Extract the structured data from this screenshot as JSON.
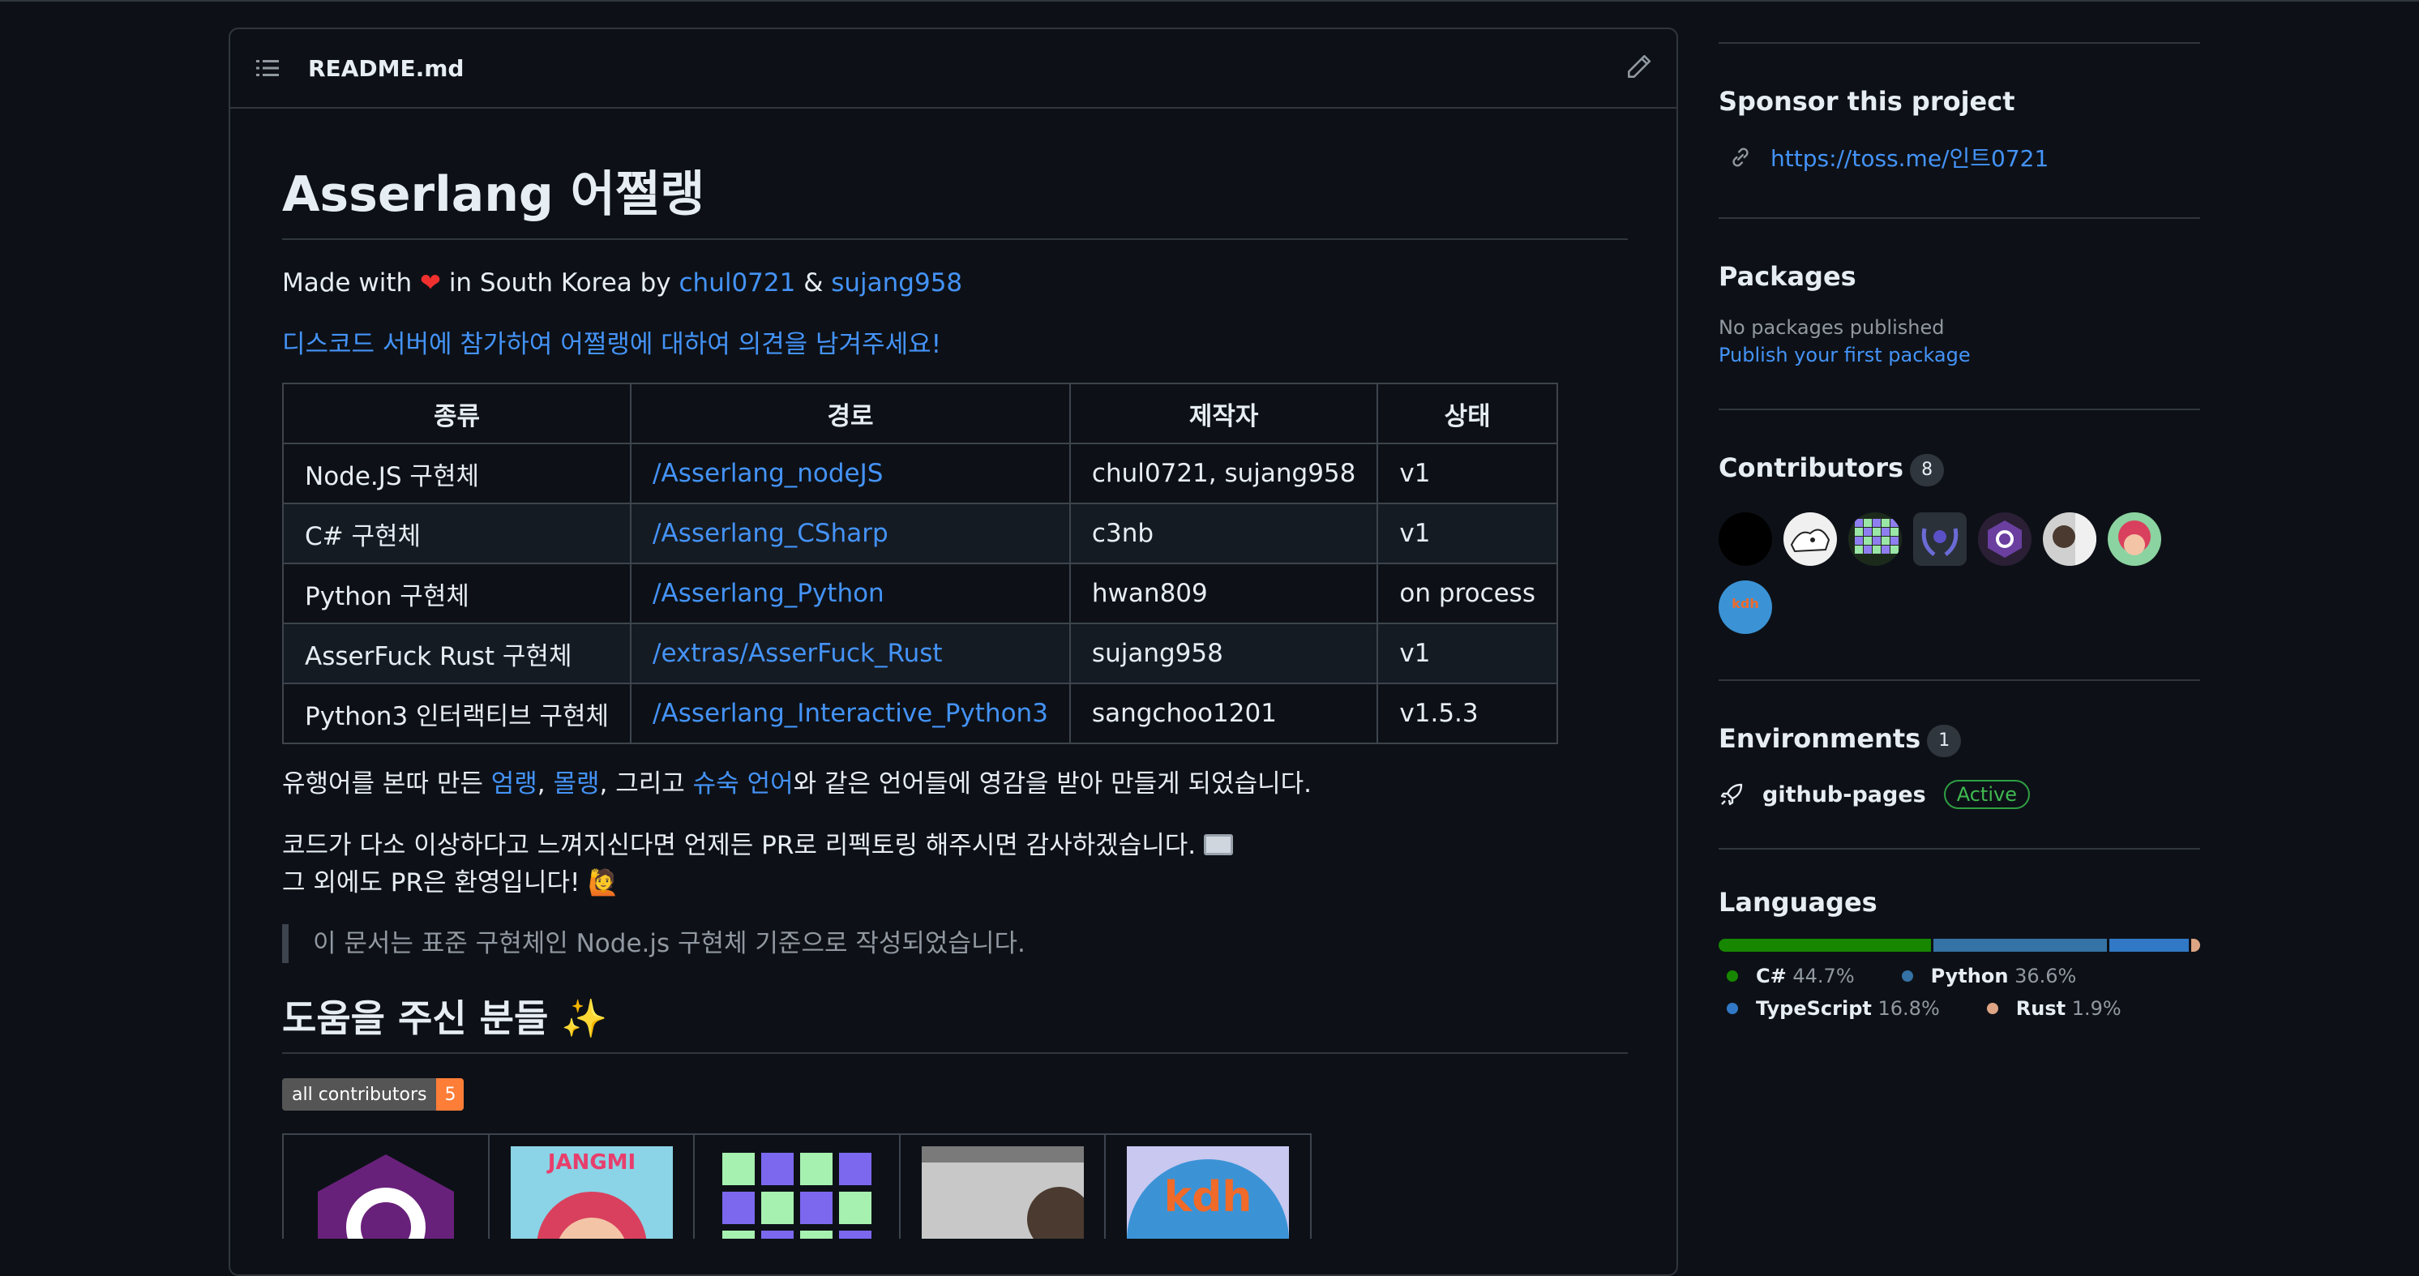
{
  "readme": {
    "filename": "README.md",
    "title": "Asserlang 어쩔랭",
    "made_prefix": "Made with ",
    "made_middle": " in South Korea by ",
    "author1": "chul0721",
    "amp": " & ",
    "author2": "sujang958",
    "discord_text": "디스코드 서버에 참가하여 어쩔랭에 대하여 의견을 남겨주세요!",
    "table": {
      "headers": [
        "종류",
        "경로",
        "제작자",
        "상태"
      ],
      "rows": [
        [
          "Node.JS 구현체",
          "/Asserlang_nodeJS",
          "chul0721, sujang958",
          "v1"
        ],
        [
          "C# 구현체",
          "/Asserlang_CSharp",
          "c3nb",
          "v1"
        ],
        [
          "Python 구현체",
          "/Asserlang_Python",
          "hwan809",
          "on process"
        ],
        [
          "AsserFuck Rust 구현체",
          "/extras/AsserFuck_Rust",
          "sujang958",
          "v1"
        ],
        [
          "Python3 인터랙티브 구현체",
          "/Asserlang_Interactive_Python3",
          "sangchoo1201",
          "v1.5.3"
        ]
      ]
    },
    "inspire": {
      "p1": "유행어를 본따 만든 ",
      "l1": "엄랭",
      "p2": ", ",
      "l2": "몰랭",
      "p3": ", 그리고 ",
      "l3": "슈숙 언어",
      "p4": "와 같은 언어들에 영감을 받아 만들게 되었습니다."
    },
    "pr_line1": "코드가 다소 이상하다고 느껴지신다면 언제든 PR로 리펙토링 해주시면 감사하겠습니다.",
    "pr_line2": "그 외에도 PR은 환영입니다!",
    "wave_emoji": "🙋",
    "heart_emoji": "❤",
    "quote": "이 문서는 표준 구현체인 Node.js 구현체 기준으로 작성되었습니다.",
    "helpers_title": "도움을 주신 분들",
    "sparkles": "✨",
    "badge_label": "all contributors",
    "badge_count": "5"
  },
  "sidebar": {
    "sponsor_title": "Sponsor this project",
    "sponsor_link": "https://toss.me/인트0721",
    "packages_title": "Packages",
    "packages_none": "No packages published",
    "packages_link": "Publish your first package",
    "contributors_title": "Contributors",
    "contributors_count": "8",
    "environments_title": "Environments",
    "environments_count": "1",
    "env_name": "github-pages",
    "env_status": "Active",
    "languages_title": "Languages",
    "languages": [
      {
        "name": "C#",
        "percent": "44.7%",
        "value": 44.7,
        "color": "#178600"
      },
      {
        "name": "Python",
        "percent": "36.6%",
        "value": 36.6,
        "color": "#3572A5"
      },
      {
        "name": "TypeScript",
        "percent": "16.8%",
        "value": 16.8,
        "color": "#3178c6"
      },
      {
        "name": "Rust",
        "percent": "1.9%",
        "value": 1.9,
        "color": "#dea584"
      }
    ]
  }
}
